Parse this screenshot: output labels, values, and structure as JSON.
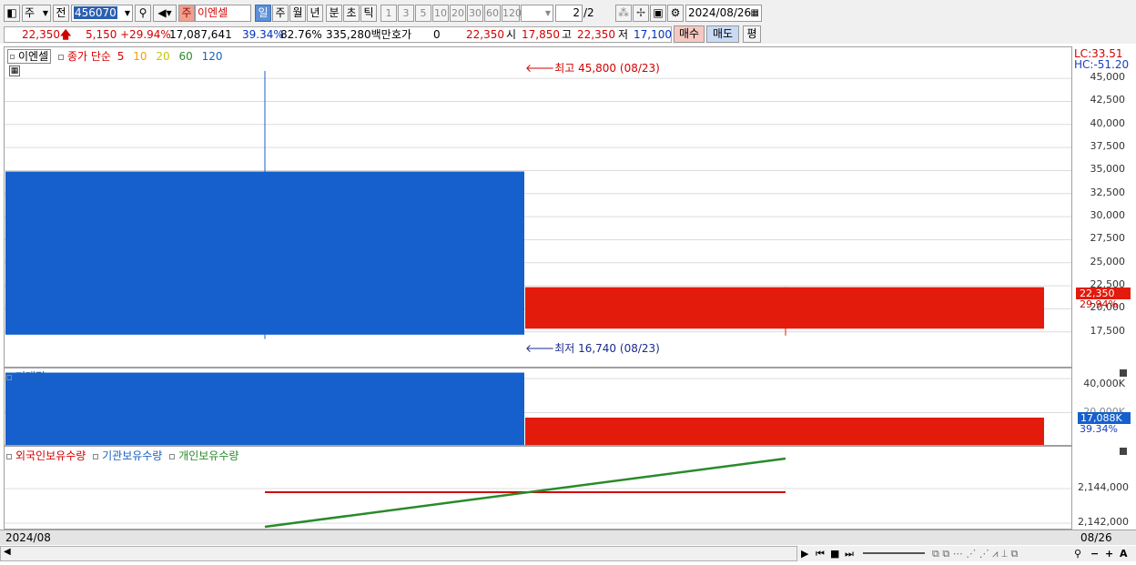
{
  "toolbar": {
    "type_label": "주",
    "market_label": "전",
    "code": "456070",
    "stock_badge": "주",
    "stock_name": "이엔셀",
    "periods": [
      "일",
      "주",
      "월",
      "년",
      "분",
      "초",
      "틱"
    ],
    "selected_period": "일",
    "intervals": [
      "1",
      "3",
      "5",
      "10",
      "20",
      "30",
      "60",
      "120"
    ],
    "page": "2",
    "page_total": "/2",
    "date": "2024/08/26"
  },
  "quote": {
    "price": "22,350",
    "change": "5,150",
    "change_pct": "+29.94%",
    "volume": "17,087,641",
    "volume_pct": "39.34%",
    "turnover_pct": "82.76%",
    "amount": "335,280백만",
    "hoga_label": "호가",
    "hoga_value": "0",
    "hoga_price": "22,350",
    "open_label": "시",
    "open": "17,850",
    "high_label": "고",
    "high": "22,350",
    "low_label": "저",
    "low": "17,100",
    "buy_label": "매수",
    "sell_label": "매도",
    "avg_label": "평"
  },
  "price_panel": {
    "name_label": "이엔셀",
    "ma_label": "종가 단순",
    "ma_periods": [
      "5",
      "10",
      "20",
      "60",
      "120"
    ],
    "ma_colors": [
      "#d40000",
      "#f0a000",
      "#c8c800",
      "#2a8a2a",
      "#1a60c0"
    ],
    "high_marker": "최고 45,800 (08/23)",
    "low_marker": "최저 16,740 (08/23)",
    "lc": "LC:33.51",
    "hc": "HC:-51.20",
    "y_ticks": [
      "45,000",
      "42,500",
      "40,000",
      "37,500",
      "35,000",
      "32,500",
      "30,000",
      "27,500",
      "25,000",
      "22,500",
      "20,000",
      "17,500"
    ],
    "current_price_tag": "22,350",
    "current_pct_tag": "29.94%"
  },
  "volume_panel": {
    "label": "거래량",
    "y_ticks": [
      "40,000K",
      "20,000K"
    ],
    "current_tag": "17,088K",
    "current_pct": "39.34%"
  },
  "holding_panel": {
    "legend": [
      "외국인보유수량",
      "기관보유수량",
      "개인보유수량"
    ],
    "legend_colors": [
      "#d40000",
      "#1a60c0",
      "#2a8a2a"
    ],
    "y_ticks": [
      "2,144,000",
      "2,142,000"
    ]
  },
  "footer": {
    "left_date": "2024/08",
    "right_date": "08/26"
  },
  "chart_data": {
    "type": "candlestick",
    "categories": [
      "08/23",
      "08/26"
    ],
    "candles": [
      {
        "date": "08/23",
        "open": 34900,
        "high": 45800,
        "low": 16740,
        "close": 17200,
        "color": "#1560cc"
      },
      {
        "date": "08/26",
        "open": 17850,
        "high": 22350,
        "low": 17100,
        "close": 22350,
        "color": "#e21b0c"
      }
    ],
    "volume": [
      {
        "date": "08/23",
        "value": 43500000,
        "color": "#1560cc"
      },
      {
        "date": "08/26",
        "value": 17087641,
        "color": "#e21b0c"
      }
    ],
    "ylim_price": [
      16000,
      46000
    ],
    "ylim_volume": [
      0,
      45000000
    ]
  }
}
